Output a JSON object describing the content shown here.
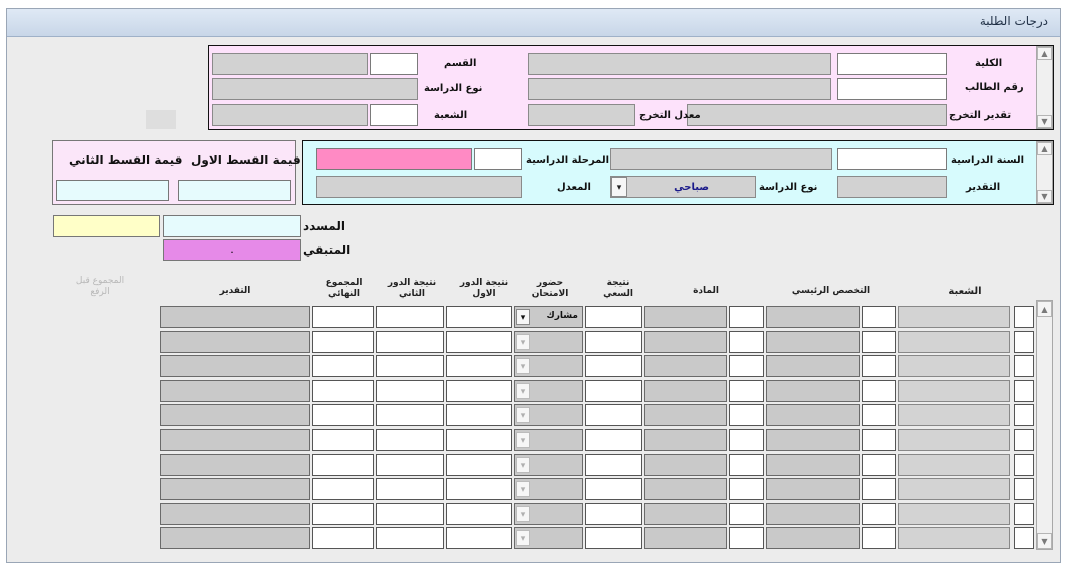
{
  "window": {
    "title": "درجات الطلبة"
  },
  "student_panel": {
    "college_label": "الكلية",
    "student_no_label": "رقم الطالب",
    "grad_grade_label": "تقدير التخرج",
    "grad_avg_label": "معدل التخرج",
    "department_label": "القسم",
    "study_type_label": "نوع الدراسة",
    "branch_label": "الشعبة"
  },
  "year_panel": {
    "study_year_label": "السنة الدراسية",
    "grade_label": "التقدير",
    "study_type_label": "نوع الدراسة",
    "study_type_value": "صباحي",
    "stage_label": "المرحلة الدراسية",
    "avg_label": "المعدل"
  },
  "payments": {
    "first_label": "قيمة القسط الاول",
    "second_label": "قيمة القسط الثاني",
    "paid_label": "المسدد",
    "remaining_label": "المتبقي",
    "remaining_value": "."
  },
  "grid": {
    "headers": {
      "branch": "الشعبة",
      "main_spec": "التخصص الرئيسي",
      "subject": "المادة",
      "effort": "نتيجة السعي",
      "attendance": "حضور الامتحان",
      "first_round": "نتيجة الدور الاول",
      "second_round": "نتيجة الدور الثاني",
      "final_total": "المجموع النهائي",
      "grade": "التقدير",
      "before_raise": "المجموع قبل الرفع"
    },
    "first_row_attendance": "مشارك",
    "row_count": 10
  },
  "icons": {
    "scroll_up": "scroll-up-icon",
    "scroll_down": "scroll-down-icon",
    "dropdown": "dropdown-arrow-icon"
  },
  "colors": {
    "student_panel_bg": "#fde2fb",
    "year_panel_bg": "#d7fbfd",
    "stage_value_bg": "#ff8ac4",
    "paid_bg": "#ffffc8",
    "remaining_bg": "#e68ae8"
  }
}
